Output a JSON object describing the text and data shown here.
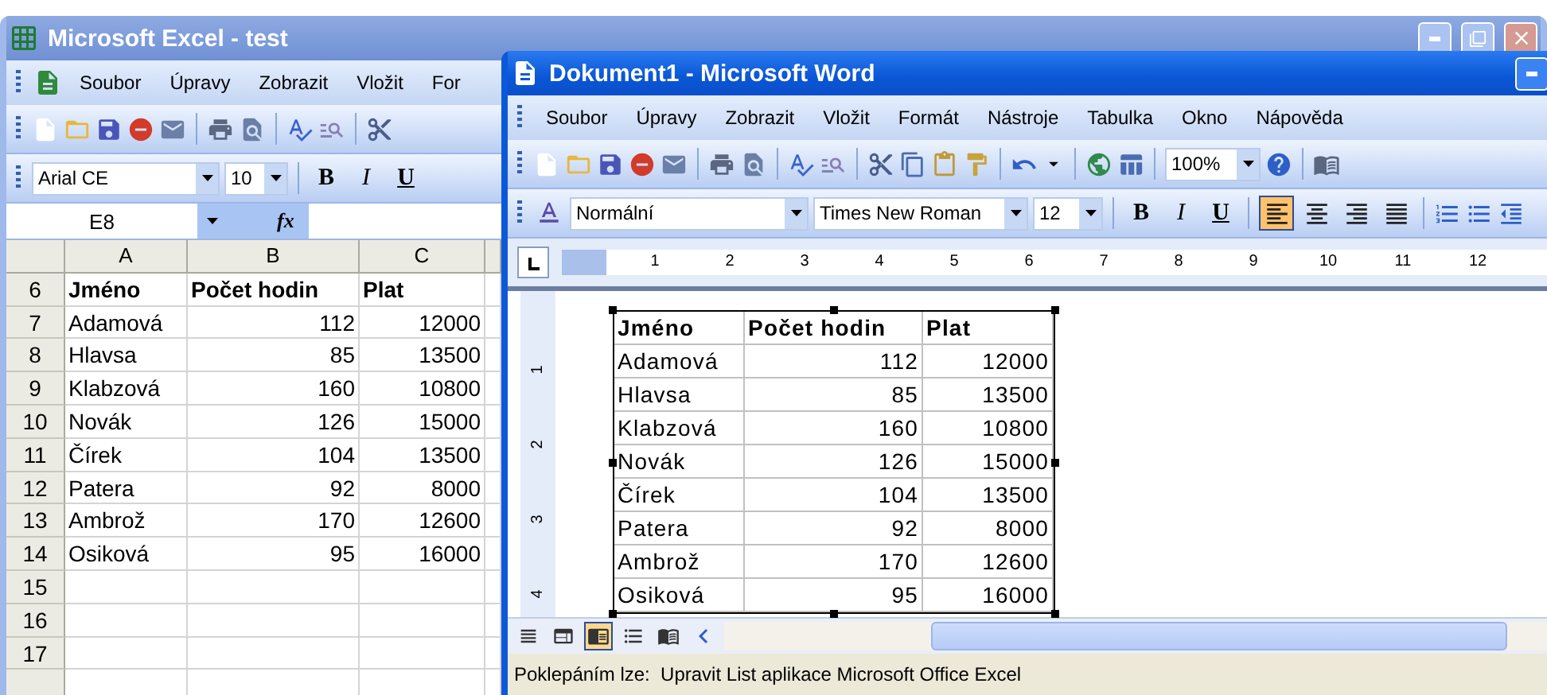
{
  "excel": {
    "title": "Microsoft Excel - test",
    "menu": [
      "Soubor",
      "Úpravy",
      "Zobrazit",
      "Vložit",
      "For"
    ],
    "font": "Arial CE",
    "font_size": "10",
    "format_buttons": [
      "B",
      "I",
      "U"
    ],
    "name_box": "E8",
    "function_label": "fx",
    "columns": [
      "A",
      "B",
      "C"
    ],
    "rows": [
      {
        "number": "6",
        "bold": true,
        "cells": [
          "Jméno",
          "Počet hodin",
          "Plat"
        ]
      },
      {
        "number": "7",
        "bold": false,
        "cells": [
          "Adamová",
          "112",
          "12000"
        ]
      },
      {
        "number": "8",
        "bold": false,
        "cells": [
          "Hlavsa",
          "85",
          "13500"
        ]
      },
      {
        "number": "9",
        "bold": false,
        "cells": [
          "Klabzová",
          "160",
          "10800"
        ]
      },
      {
        "number": "10",
        "bold": false,
        "cells": [
          "Novák",
          "126",
          "15000"
        ]
      },
      {
        "number": "11",
        "bold": false,
        "cells": [
          "Čírek",
          "104",
          "13500"
        ]
      },
      {
        "number": "12",
        "bold": false,
        "cells": [
          "Patera",
          "92",
          "8000"
        ]
      },
      {
        "number": "13",
        "bold": false,
        "cells": [
          "Ambrož",
          "170",
          "12600"
        ]
      },
      {
        "number": "14",
        "bold": false,
        "cells": [
          "Osiková",
          "95",
          "16000"
        ]
      }
    ],
    "empty_rows": [
      "15",
      "16",
      "17"
    ]
  },
  "word": {
    "title": "Dokument1 - Microsoft Word",
    "menu": [
      "Soubor",
      "Úpravy",
      "Zobrazit",
      "Vložit",
      "Formát",
      "Nástroje",
      "Tabulka",
      "Okno",
      "Nápověda"
    ],
    "zoom": "100%",
    "style": "Normální",
    "font": "Times New Roman",
    "font_size": "12",
    "format_buttons": [
      "B",
      "I",
      "U"
    ],
    "alignment": [
      {
        "kind": "left",
        "selected": true
      },
      {
        "kind": "center",
        "selected": false
      },
      {
        "kind": "right",
        "selected": false
      },
      {
        "kind": "justify",
        "selected": false
      }
    ],
    "ruler": [
      "1",
      "2",
      "3",
      "4",
      "5",
      "6",
      "7",
      "8",
      "9",
      "10",
      "11",
      "12"
    ],
    "vertical_ruler": [
      "1",
      "2",
      "3",
      "4"
    ],
    "table": {
      "selected": true,
      "rows": [
        {
          "bold": true,
          "cells": [
            "Jméno",
            "Počet hodin",
            "Plat"
          ]
        },
        {
          "bold": false,
          "cells": [
            "Adamová",
            "112",
            "12000"
          ]
        },
        {
          "bold": false,
          "cells": [
            "Hlavsa",
            "85",
            "13500"
          ]
        },
        {
          "bold": false,
          "cells": [
            "Klabzová",
            "160",
            "10800"
          ]
        },
        {
          "bold": false,
          "cells": [
            "Novák",
            "126",
            "15000"
          ]
        },
        {
          "bold": false,
          "cells": [
            "Čírek",
            "104",
            "13500"
          ]
        },
        {
          "bold": false,
          "cells": [
            "Patera",
            "92",
            "8000"
          ]
        },
        {
          "bold": false,
          "cells": [
            "Ambrož",
            "170",
            "12600"
          ]
        },
        {
          "bold": false,
          "cells": [
            "Osiková",
            "95",
            "16000"
          ]
        }
      ]
    },
    "views": [
      {
        "kind": "normal",
        "selected": false
      },
      {
        "kind": "web",
        "selected": false
      },
      {
        "kind": "print",
        "selected": true
      },
      {
        "kind": "outline",
        "selected": false
      },
      {
        "kind": "reading",
        "selected": false
      }
    ],
    "status": "Poklepáním lze:  Upravit List aplikace Microsoft Office Excel"
  }
}
